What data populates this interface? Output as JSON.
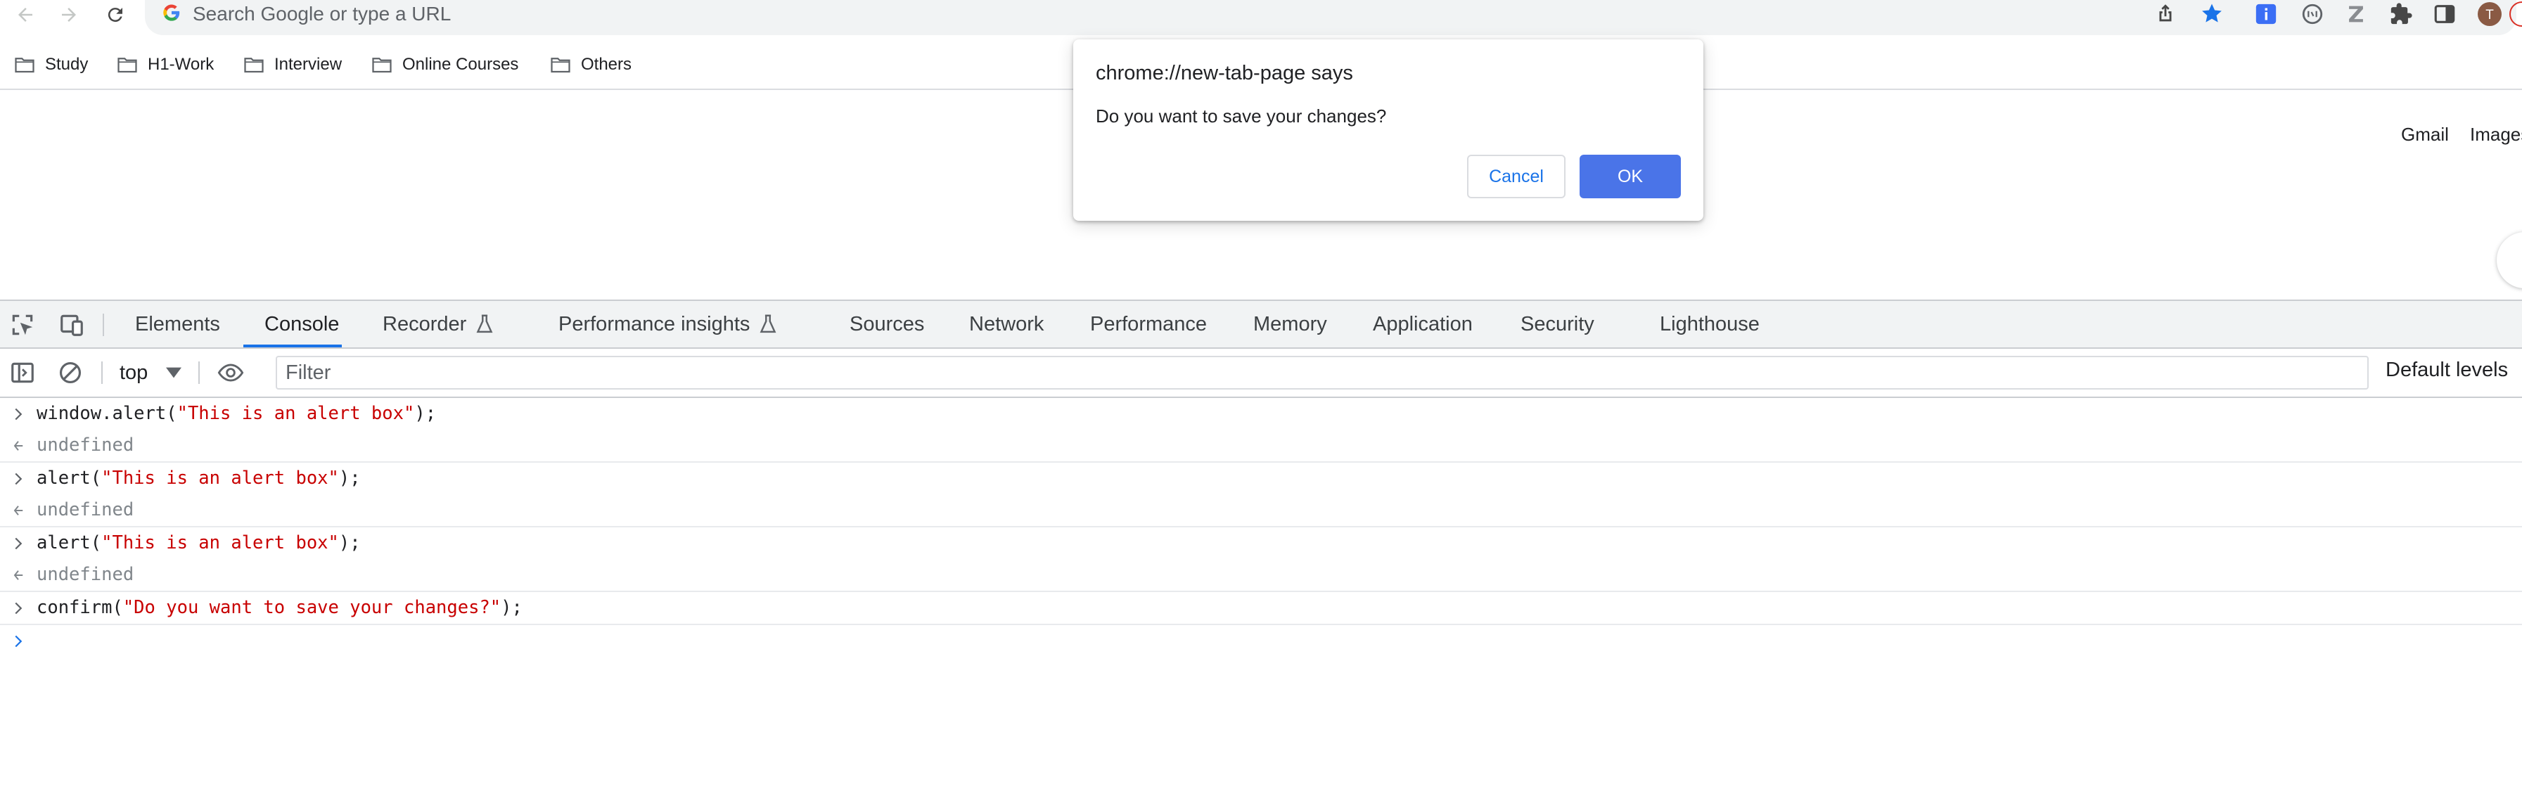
{
  "browser": {
    "omnibox_placeholder": "Search Google or type a URL",
    "nav_icons": [
      "back-icon",
      "forward-icon",
      "reload-icon"
    ],
    "omnibox_icons": [
      "share-icon",
      "bookmark-star-icon"
    ],
    "extension_icons": [
      "extension-blue-icon",
      "extension-circle-icon",
      "extension-z-icon",
      "puzzle-icon",
      "side-panel-icon",
      "profile-avatar"
    ],
    "profile_initial": "T",
    "accent_color": "#1a73e8"
  },
  "bookmarks": [
    {
      "label": "Study"
    },
    {
      "label": "H1-Work"
    },
    {
      "label": "Interview"
    },
    {
      "label": "Online Courses"
    },
    {
      "label": "Others"
    }
  ],
  "ntp": {
    "gmail_link": "Gmail",
    "images_link": "Images"
  },
  "dialog": {
    "title": "chrome://new-tab-page says",
    "message": "Do you want to save your changes?",
    "cancel_label": "Cancel",
    "ok_label": "OK",
    "ok_color": "#4a74e8"
  },
  "devtools": {
    "tabs": [
      {
        "label": "Elements"
      },
      {
        "label": "Console",
        "active": true
      },
      {
        "label": "Recorder",
        "icon": "flask-icon"
      },
      {
        "label": "Performance insights",
        "icon": "flask-icon"
      },
      {
        "label": "Sources"
      },
      {
        "label": "Network"
      },
      {
        "label": "Performance"
      },
      {
        "label": "Memory"
      },
      {
        "label": "Application"
      },
      {
        "label": "Security"
      },
      {
        "label": "Lighthouse"
      }
    ],
    "context": "top",
    "filter_placeholder": "Filter",
    "levels_label": "Default levels"
  },
  "console": {
    "entries": [
      {
        "fn": "window.alert(",
        "arg": "\"This is an alert box\"",
        "end": ");",
        "result": "undefined"
      },
      {
        "fn": "alert(",
        "arg": "\"This is an alert box\"",
        "end": ");",
        "result": "undefined"
      },
      {
        "fn": "alert(",
        "arg": "\"This is an alert box\"",
        "end": ");",
        "result": "undefined"
      },
      {
        "fn": "confirm(",
        "arg": "\"Do you want to save your changes?\"",
        "end": ");"
      }
    ]
  }
}
